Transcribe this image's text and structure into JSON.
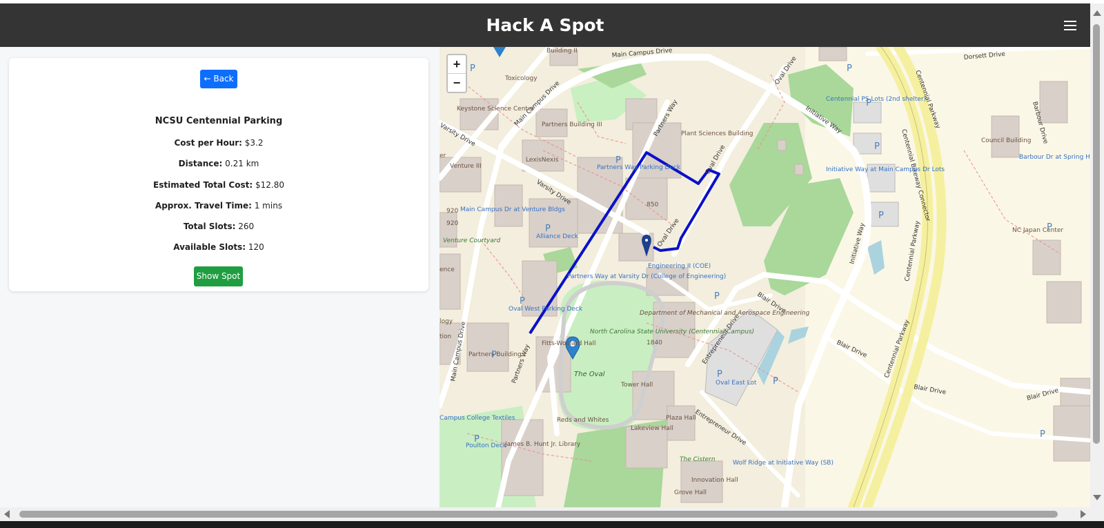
{
  "app": {
    "title": "Hack A Spot"
  },
  "details": {
    "back_label": "← Back",
    "parking_name": "NCSU Centennial Parking",
    "fields": [
      {
        "label": "Cost per Hour:",
        "value": "$3.2"
      },
      {
        "label": "Distance:",
        "value": "0.21 km"
      },
      {
        "label": "Estimated Total Cost:",
        "value": "$12.80"
      },
      {
        "label": "Approx. Travel Time:",
        "value": "1 mins"
      },
      {
        "label": "Total Slots:",
        "value": "260"
      },
      {
        "label": "Available Slots:",
        "value": "120"
      }
    ],
    "show_spot_label": "Show Spot"
  },
  "map": {
    "zoom_in": "+",
    "zoom_out": "−",
    "labels": {
      "main_campus_drive_top": "Main Campus Drive",
      "main_campus_drive_diag": "Main Campus Drive",
      "main_campus_drive_lower": "Main Campus Drive",
      "varsity_drive_left": "Varsity Drive",
      "varsity_drive_mid": "Varsity Drive",
      "partners_way_top": "Partners Way",
      "partners_way_bottom": "Partners Way",
      "oval_drive_top": "Oval Drive",
      "oval_drive_mid": "Oval Drive",
      "initiative_way_top": "Initiative Way",
      "initiative_way_right": "Initiative Way",
      "centennial_parkway_top": "Centennial Parkway",
      "centennial_parkway_mid": "Centennial Parkway",
      "centennial_parkway_bottom": "Centennial Parkway",
      "centennial_bikeway": "Centennial Bikeway Connector",
      "dorsett_drive": "Dorsett Drive",
      "barbour_drive": "Barbour Drive",
      "blair_drive_1": "Blair Drive",
      "blair_drive_2": "Blair Drive",
      "blair_drive_3": "Blair Drive",
      "blair_drive_4": "Blair Drive",
      "entrepreneur_drive_1": "Entrepreneur Drive",
      "entrepreneur_drive_2": "Entrepreneur Drive",
      "toxicology": "Toxicology",
      "building_ii": "Building II",
      "keystone": "Keystone Science Center",
      "partners_iii": "Partners Building III",
      "lexisnexis": "LexisNexis",
      "venture_iii": "Venture III",
      "plant_sciences": "Plant Sciences Building",
      "partners_way_deck": "Partners Way Parking Deck",
      "b850": "850",
      "main_campus_stop": "Main Campus Dr at Venture Bldgs",
      "b920a": "920",
      "b920b": "920",
      "venture_courtyard": "Venture Courtyard",
      "alliance_deck": "Alliance Deck",
      "engineering_ii": "Engineering II (COE)",
      "partners_varsity_stop": "Partners Way at Varsity Dr (College of Engineering)",
      "oval_west_deck": "Oval West Parking Deck",
      "ncsu_centennial": "North Carolina State University (Centennial Campus)",
      "mech_aero": "Department of Mechanical and Aerospace Engineering",
      "b1840": "1840",
      "fitts_woolard": "Fitts-Woolard Hall",
      "the_oval": "The Oval",
      "partners_i": "Partners Building I",
      "tower_hall": "Tower Hall",
      "reds_whites": "Reds and Whites",
      "plaza_hall": "Plaza Hall",
      "lakeview_hall": "Lakeview Hall",
      "poulton_deck": "Poulton Deck",
      "hunt_library": "James B. Hunt Jr. Library",
      "campus_college_textiles": "Campus College Textiles",
      "the_cistern": "The Cistern",
      "wolf_ridge_stop": "Wolf Ridge at Initiative Way (SB)",
      "innovation_hall": "Innovation Hall",
      "grove_hall": "Grove Hall",
      "centennial_ps_lots": "Centennial PS Lots (2nd shelter)",
      "initiative_way_stop": "Initiative Way at Main Campus Dr Lots",
      "council_building": "Council Building",
      "barbour_spring_hill": "Barbour Dr at Spring Hill Lot",
      "nc_japan_center": "NC Japan Center",
      "oval_east_lot": "Oval East Lot",
      "logy": "logy",
      "ence": "ence",
      "tion": "tion",
      "er": "er"
    }
  }
}
